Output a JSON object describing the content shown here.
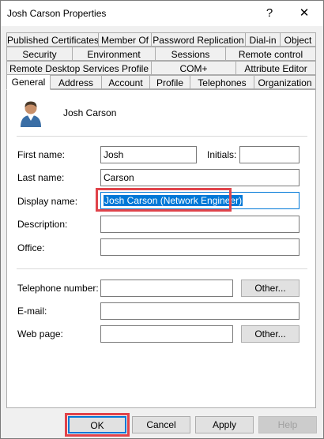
{
  "window": {
    "title": "Josh Carson Properties",
    "help_glyph": "?",
    "close_glyph": "✕"
  },
  "tabs": {
    "row1": [
      "Published Certificates",
      "Member Of",
      "Password Replication",
      "Dial-in",
      "Object"
    ],
    "row2": [
      "Security",
      "Environment",
      "Sessions",
      "Remote control"
    ],
    "row3": [
      "Remote Desktop Services Profile",
      "COM+",
      "Attribute Editor"
    ],
    "row4": [
      "General",
      "Address",
      "Account",
      "Profile",
      "Telephones",
      "Organization"
    ],
    "active": "General"
  },
  "general": {
    "user_name": "Josh Carson",
    "first_name_label": "First name:",
    "first_name": "Josh",
    "initials_label": "Initials:",
    "initials": "",
    "last_name_label": "Last name:",
    "last_name": "Carson",
    "display_name_label": "Display name:",
    "display_name": "Josh Carson (Network Engineer)",
    "description_label": "Description:",
    "description": "",
    "office_label": "Office:",
    "office": "",
    "telephone_label": "Telephone number:",
    "telephone": "",
    "telephone_other": "Other...",
    "email_label": "E-mail:",
    "email": "",
    "webpage_label": "Web page:",
    "webpage": "",
    "webpage_other": "Other..."
  },
  "buttons": {
    "ok": "OK",
    "cancel": "Cancel",
    "apply": "Apply",
    "help": "Help"
  },
  "colors": {
    "highlight": "#e0434a",
    "selection": "#0078d7"
  }
}
